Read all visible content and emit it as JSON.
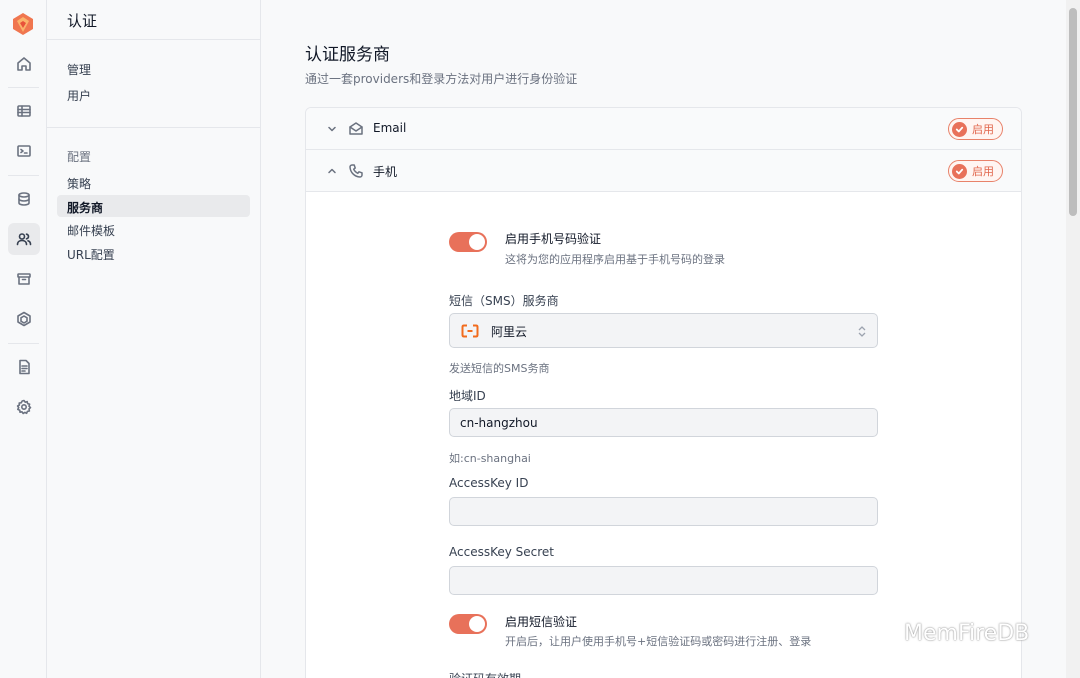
{
  "sidebar": {
    "title": "认证",
    "group1": {
      "items": [
        {
          "label": "管理"
        },
        {
          "label": "用户"
        }
      ]
    },
    "group2": {
      "title": "配置",
      "items": [
        {
          "label": "策略"
        },
        {
          "label": "服务商"
        },
        {
          "label": "邮件模板"
        },
        {
          "label": "URL配置"
        }
      ]
    }
  },
  "rail": {
    "icons": [
      "home-icon",
      "table-icon",
      "terminal-icon",
      "database-icon",
      "users-icon",
      "archive-icon",
      "package-icon",
      "document-icon",
      "gear-icon"
    ]
  },
  "main": {
    "title": "认证服务商",
    "subtitle": "通过一套providers和登录方法对用户进行身份验证",
    "providers": [
      {
        "name": "Email",
        "status": "启用",
        "icon": "mail-icon"
      },
      {
        "name": "手机",
        "status": "启用",
        "icon": "phone-icon"
      }
    ],
    "phone": {
      "enable_toggle": {
        "label": "启用手机号码验证",
        "desc": "这将为您的应用程序启用基于手机号码的登录",
        "on": true
      },
      "sms_provider": {
        "label": "短信（SMS）服务商",
        "value": "阿里云",
        "hint": "发送短信的SMS务商"
      },
      "region": {
        "label": "地域ID",
        "value": "cn-hangzhou",
        "hint": "如:cn-shanghai"
      },
      "access_key_id": {
        "label": "AccessKey ID",
        "value": ""
      },
      "access_key_secret": {
        "label": "AccessKey Secret",
        "value": ""
      },
      "sms_toggle": {
        "label": "启用短信验证",
        "desc": "开启后，让用户使用手机号+短信验证码或密码进行注册、登录",
        "on": true
      },
      "next_label": "验证码有效期"
    }
  },
  "watermark": "MemFireDB",
  "colors": {
    "accent": "#e8715a",
    "badge_text": "#e2674d"
  }
}
